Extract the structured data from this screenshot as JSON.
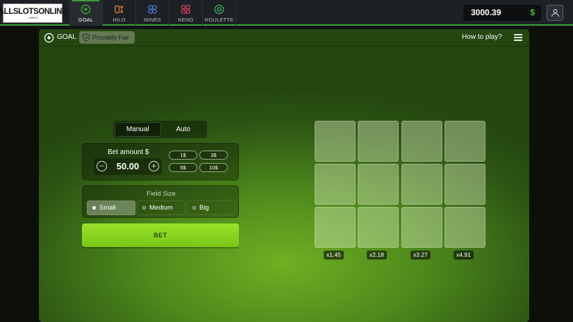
{
  "header": {
    "logo_text": "ALLSLOTSONLINE",
    "logo_sub": ".casino",
    "games": [
      {
        "label": "GOAL",
        "icon": "soccer-ball-icon",
        "active": true,
        "color": "#3ba23a"
      },
      {
        "label": "HILO",
        "icon": "hilo-arrows-icon",
        "active": false,
        "color": "#e07a3a"
      },
      {
        "label": "MINES",
        "icon": "mines-icon",
        "active": false,
        "color": "#4a7fe0"
      },
      {
        "label": "KENO",
        "icon": "keno-icon",
        "active": false,
        "color": "#d13b5c"
      },
      {
        "label": "ROULETTE",
        "icon": "roulette-icon",
        "active": false,
        "color": "#3ba25a"
      }
    ],
    "balance": "3000.39",
    "currency": "$"
  },
  "panel": {
    "title": "GOAL",
    "provably_fair": "Provably Fair",
    "how_to_play": "How to play?"
  },
  "controls": {
    "modes": [
      "Manual",
      "Auto"
    ],
    "active_mode": "Manual",
    "bet_label": "Bet amount $",
    "bet_value": "50.00",
    "quick_bets": [
      "1$",
      "3$",
      "5$",
      "10$"
    ],
    "field_size_label": "Field Size",
    "field_sizes": [
      "Small",
      "Medium",
      "Big"
    ],
    "selected_field_size": "Small",
    "bet_button": "BET"
  },
  "board": {
    "rows": 3,
    "columns": 4,
    "multipliers": [
      "x1.45",
      "x2.18",
      "x3.27",
      "x4.91"
    ]
  },
  "colors": {
    "accent": "#3ba23a",
    "bet_button": "#8fd821",
    "panel_bg": "#4e8a1c"
  }
}
